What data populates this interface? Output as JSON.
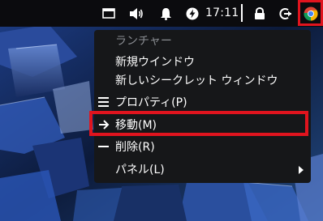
{
  "taskbar": {
    "clock": "17:11",
    "icons": [
      "window-icon",
      "speaker-icon",
      "bell-icon",
      "power-circle-icon",
      "lock-icon",
      "logout-icon",
      "chrome-icon"
    ]
  },
  "context_menu": {
    "header": "ランチャー",
    "items": [
      {
        "label": "新規ウインドウ",
        "icon": ""
      },
      {
        "label": "新しいシークレット ウィンドウ",
        "icon": ""
      },
      {
        "label": "プロパティ(P)",
        "icon": "list-icon"
      },
      {
        "label": "移動(M)",
        "icon": "arrow-right-icon"
      },
      {
        "label": "削除(R)",
        "icon": "minus-icon"
      },
      {
        "label": "パネル(L)",
        "icon": "",
        "submenu": true
      }
    ]
  },
  "colors": {
    "highlight": "#e0141e",
    "menu_bg": "#161719",
    "taskbar_bg": "#0b0b0e",
    "header_text": "#8a8d92"
  }
}
